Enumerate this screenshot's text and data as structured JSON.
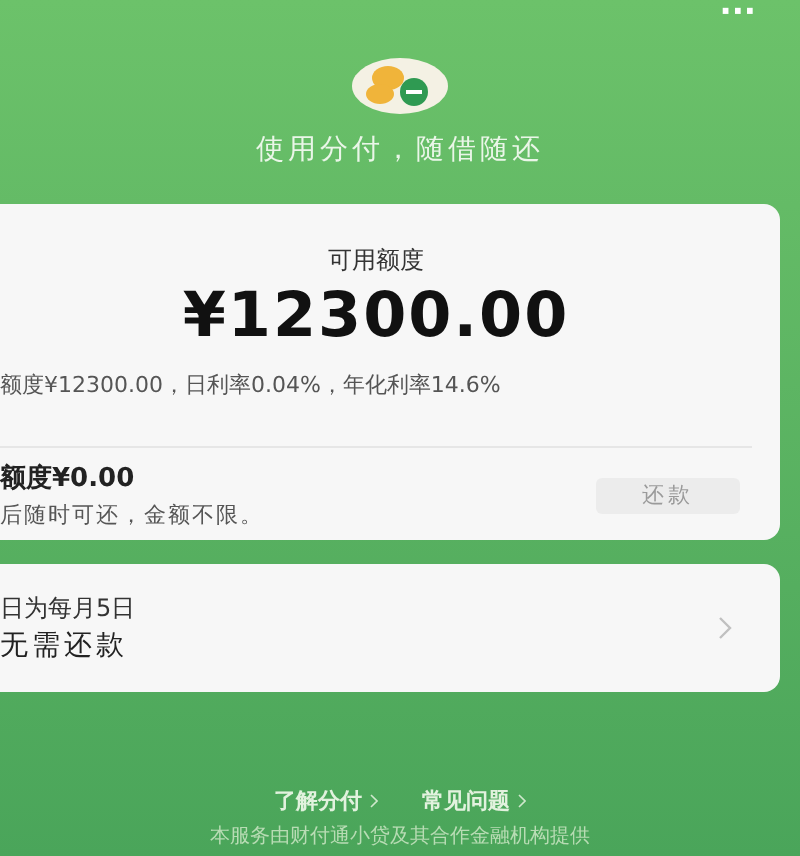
{
  "header": {
    "menu": "···",
    "tagline": "使用分付，随借随还"
  },
  "credit_card": {
    "label": "可用额度",
    "amount": "¥12300.00",
    "details": "额度¥12300.00，日利率0.04%，年化利率14.6%",
    "owed": "额度¥0.00",
    "owed_note": "后随时可还，金额不限。",
    "repay_button": {
      "label": "还款",
      "disabled": true
    }
  },
  "bill_card": {
    "line_1": "日为每月5日",
    "line_2": "无需还款"
  },
  "footer": {
    "links": [
      {
        "label": "了解分付"
      },
      {
        "label": "常见问题"
      }
    ],
    "notice": "本服务由财付通小贷及其合作金融机构提供"
  }
}
